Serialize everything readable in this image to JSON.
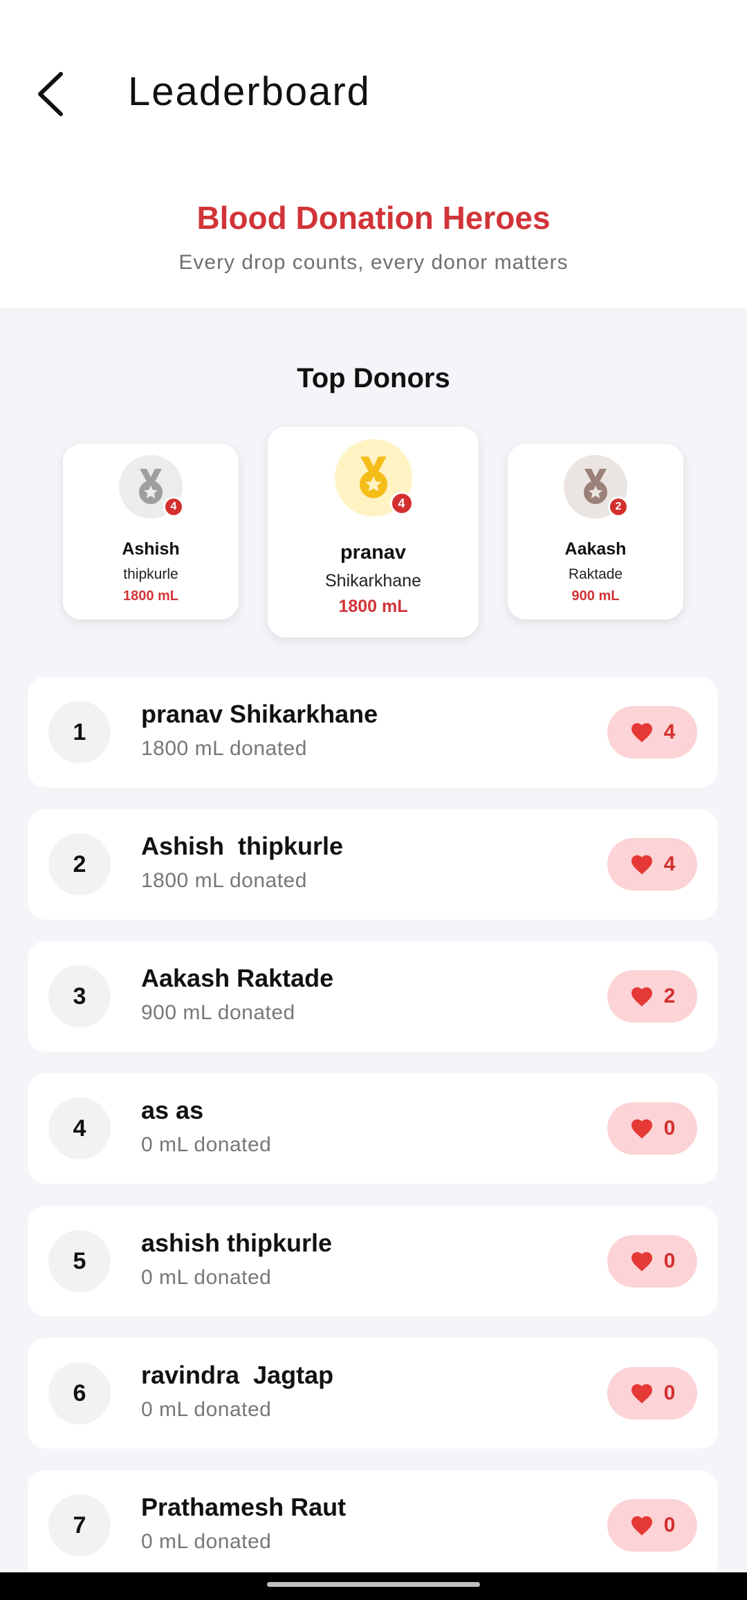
{
  "header": {
    "title": "Leaderboard",
    "back_icon": "chevron-left-icon"
  },
  "hero": {
    "title": "Blood Donation Heroes",
    "subtitle": "Every drop counts, every donor matters",
    "accent_color": "#d13438"
  },
  "top_donors": {
    "title": "Top Donors",
    "podium": [
      {
        "position": 2,
        "first": "Ashish",
        "last": "thipkurle",
        "ml": "1800 mL",
        "count": "4",
        "medal": "silver-medal-icon",
        "medal_bg": "#ececec",
        "medal_color": "#9e9e9e"
      },
      {
        "position": 1,
        "first": "pranav",
        "last": "Shikarkhane",
        "ml": "1800 mL",
        "count": "4",
        "medal": "gold-medal-icon",
        "medal_bg": "#fff3c4",
        "medal_color": "#f5bd19"
      },
      {
        "position": 3,
        "first": "Aakash",
        "last": "Raktade",
        "ml": "900 mL",
        "count": "2",
        "medal": "bronze-medal-icon",
        "medal_bg": "#ebe5e2",
        "medal_color": "#9b8178"
      }
    ]
  },
  "leaderboard": [
    {
      "rank": "1",
      "name": "pranav Shikarkhane",
      "donated": "1800 mL donated",
      "count": "4"
    },
    {
      "rank": "2",
      "name": "Ashish  thipkurle",
      "donated": "1800 mL donated",
      "count": "4"
    },
    {
      "rank": "3",
      "name": "Aakash Raktade",
      "donated": "900 mL donated",
      "count": "2"
    },
    {
      "rank": "4",
      "name": "as as",
      "donated": "0 mL donated",
      "count": "0"
    },
    {
      "rank": "5",
      "name": "ashish thipkurle",
      "donated": "0 mL donated",
      "count": "0"
    },
    {
      "rank": "6",
      "name": "ravindra  Jagtap",
      "donated": "0 mL donated",
      "count": "0"
    },
    {
      "rank": "7",
      "name": "Prathamesh Raut",
      "donated": "0 mL donated",
      "count": "0"
    }
  ],
  "colors": {
    "count_pill_bg": "#fcd3d6",
    "heart": "#e53935",
    "page_bg": "#f4f5f8"
  }
}
